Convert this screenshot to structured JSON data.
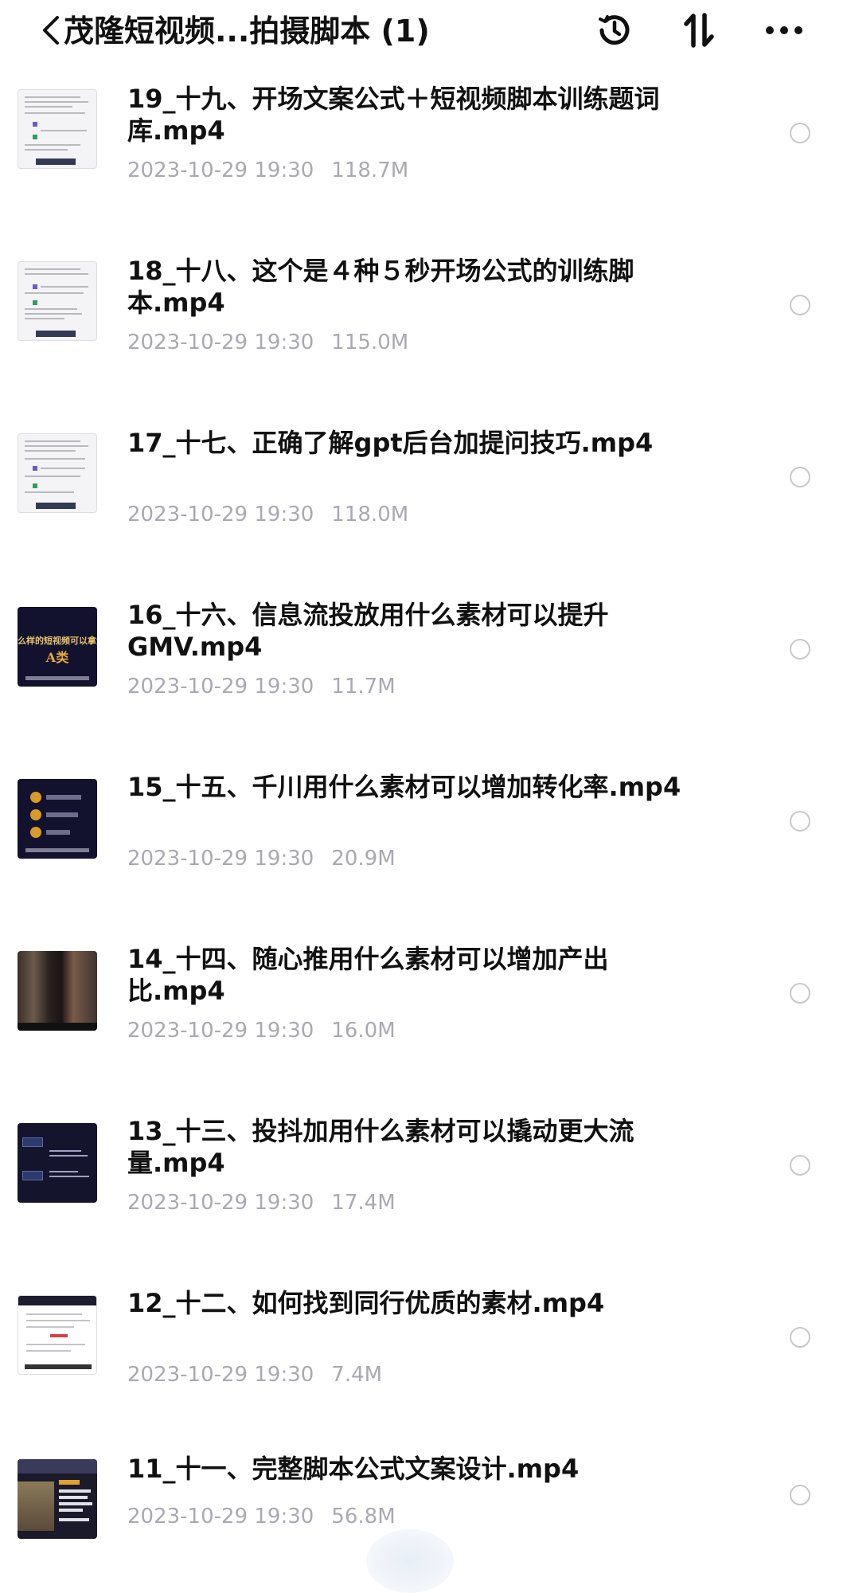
{
  "header": {
    "title": "茂隆短视频...拍摄脚本 (1)",
    "back_icon": "chevron-left-icon",
    "history_icon": "history-clock-icon",
    "sort_icon": "sort-arrows-icon",
    "more_icon": "more-dots-icon"
  },
  "files": [
    {
      "title": "19_十九、开场文案公式＋短视频脚本训练题词库.mp4",
      "date": "2023-10-29 19:30",
      "size": "118.7M",
      "thumb": "doc"
    },
    {
      "title": "18_十八、这个是４种５秒开场公式的训练脚本.mp4",
      "date": "2023-10-29 19:30",
      "size": "115.0M",
      "thumb": "doc"
    },
    {
      "title": "17_十七、正确了解gpt后台加提问技巧.mp4",
      "date": "2023-10-29 19:30",
      "size": "118.0M",
      "thumb": "doc"
    },
    {
      "title": "16_十六、信息流投放用什么素材可以提升GMV.mp4",
      "date": "2023-10-29 19:30",
      "size": "11.7M",
      "thumb": "dark-gold",
      "thumb_text": "么样的短视频可以拿大",
      "thumb_text2": "A类"
    },
    {
      "title": "15_十五、千川用什么素材可以增加转化率.mp4",
      "date": "2023-10-29 19:30",
      "size": "20.9M",
      "thumb": "dark-nodes"
    },
    {
      "title": "14_十四、随心推用什么素材可以增加产出比.mp4",
      "date": "2023-10-29 19:30",
      "size": "16.0M",
      "thumb": "photo"
    },
    {
      "title": "13_十三、投抖加用什么素材可以撬动更大流量.mp4",
      "date": "2023-10-29 19:30",
      "size": "17.4M",
      "thumb": "mind"
    },
    {
      "title": "12_十二、如何找到同行优质的素材.mp4",
      "date": "2023-10-29 19:30",
      "size": "7.4M",
      "thumb": "web"
    },
    {
      "title": "11_十一、完整脚本公式文案设计.mp4",
      "date": "2023-10-29 19:30",
      "size": "56.8M",
      "thumb": "mix"
    }
  ],
  "row_select_icon": "radio-circle-icon"
}
